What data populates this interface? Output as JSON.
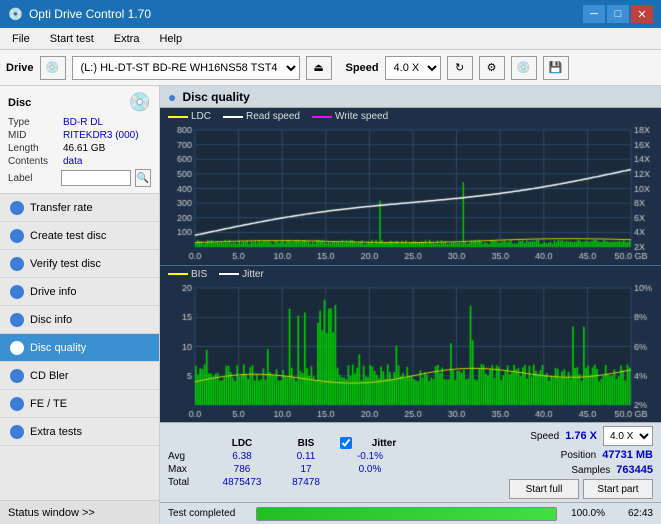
{
  "app": {
    "title": "Opti Drive Control 1.70",
    "icon": "💿"
  },
  "titlebar": {
    "minimize": "─",
    "maximize": "□",
    "close": "✕"
  },
  "menu": {
    "items": [
      "File",
      "Start test",
      "Extra",
      "Help"
    ]
  },
  "toolbar": {
    "drive_label": "Drive",
    "drive_value": "(L:)  HL-DT-ST BD-RE  WH16NS58 TST4",
    "speed_label": "Speed",
    "speed_value": "4.0 X"
  },
  "disc": {
    "section_title": "Disc",
    "type_label": "Type",
    "type_value": "BD-R DL",
    "mid_label": "MID",
    "mid_value": "RITEKDR3 (000)",
    "length_label": "Length",
    "length_value": "46.61 GB",
    "contents_label": "Contents",
    "contents_value": "data",
    "label_label": "Label",
    "label_value": ""
  },
  "nav": {
    "items": [
      {
        "id": "transfer-rate",
        "label": "Transfer rate",
        "active": false
      },
      {
        "id": "create-test-disc",
        "label": "Create test disc",
        "active": false
      },
      {
        "id": "verify-test-disc",
        "label": "Verify test disc",
        "active": false
      },
      {
        "id": "drive-info",
        "label": "Drive info",
        "active": false
      },
      {
        "id": "disc-info",
        "label": "Disc info",
        "active": false
      },
      {
        "id": "disc-quality",
        "label": "Disc quality",
        "active": true
      },
      {
        "id": "cd-bler",
        "label": "CD Bler",
        "active": false
      },
      {
        "id": "fe-te",
        "label": "FE / TE",
        "active": false
      },
      {
        "id": "extra-tests",
        "label": "Extra tests",
        "active": false
      }
    ]
  },
  "status_window": {
    "label": "Status window >> "
  },
  "disc_quality": {
    "title": "Disc quality",
    "legend_upper": {
      "ldc": "LDC",
      "read_speed": "Read speed",
      "write_speed": "Write speed"
    },
    "legend_lower": {
      "bis": "BIS",
      "jitter": "Jitter"
    },
    "y_axis_upper": [
      "18X",
      "16X",
      "14X",
      "12X",
      "10X",
      "8X",
      "6X",
      "4X",
      "2X"
    ],
    "y_axis_upper_left": [
      "800",
      "700",
      "600",
      "500",
      "400",
      "300",
      "200",
      "100"
    ],
    "x_axis": [
      "0.0",
      "5.0",
      "10.0",
      "15.0",
      "20.0",
      "25.0",
      "30.0",
      "35.0",
      "40.0",
      "45.0",
      "50.0 GB"
    ],
    "y_axis_lower_left": [
      "20",
      "15",
      "10",
      "5"
    ],
    "y_axis_lower_right": [
      "10%",
      "8%",
      "6%",
      "4%",
      "2%"
    ]
  },
  "stats": {
    "headers": [
      "",
      "LDC",
      "BIS",
      "",
      "Jitter",
      "Speed",
      "1.76 X"
    ],
    "avg_label": "Avg",
    "avg_ldc": "6.38",
    "avg_bis": "0.11",
    "avg_jitter": "-0.1%",
    "max_label": "Max",
    "max_ldc": "786",
    "max_bis": "17",
    "max_jitter": "0.0%",
    "total_label": "Total",
    "total_ldc": "4875473",
    "total_bis": "87478",
    "position_label": "Position",
    "position_value": "47731 MB",
    "samples_label": "Samples",
    "samples_value": "763445",
    "speed_label": "Speed",
    "speed_value": "1.76 X",
    "speed_select": "4.0 X",
    "start_full": "Start full",
    "start_part": "Start part"
  },
  "progress": {
    "status_text": "Test completed",
    "percent": "100.0%",
    "time": "62:43"
  },
  "colors": {
    "accent_blue": "#3a90d0",
    "chart_bg": "#1a2a3a",
    "grid": "#2a4a6a",
    "ldc_color": "#ffff00",
    "bis_color": "#ffff00",
    "read_speed_color": "#ffffff",
    "write_speed_color": "#ff00ff",
    "green_bars": "#00dd00",
    "jitter_color": "#ffffff"
  }
}
